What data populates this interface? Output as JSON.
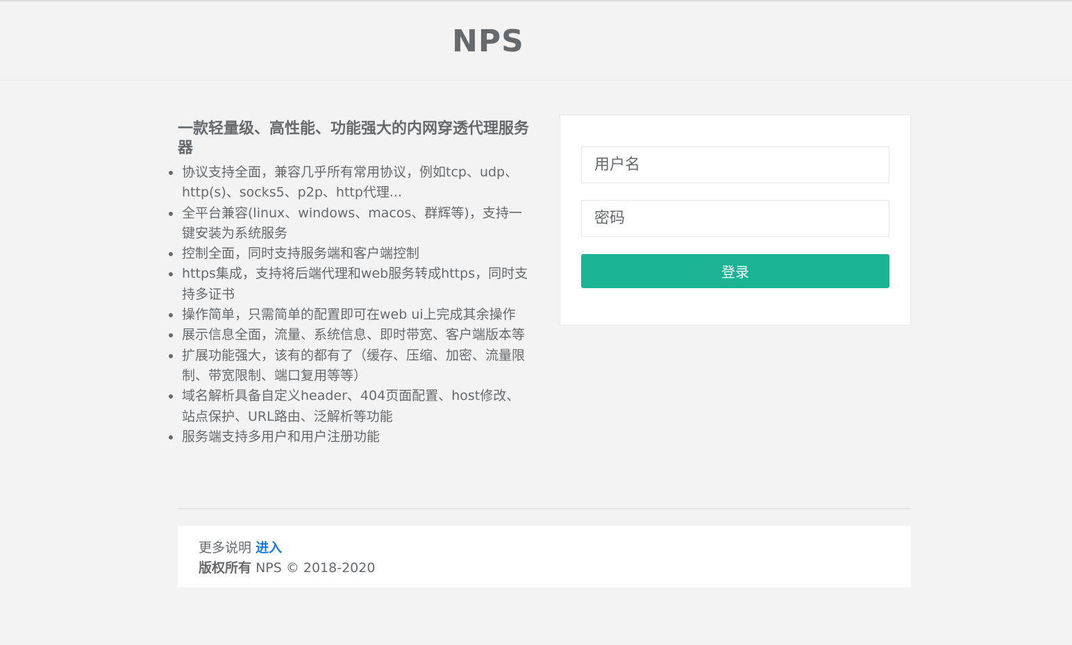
{
  "header": {
    "brand": "NPS"
  },
  "intro": {
    "title": "一款轻量级、高性能、功能强大的内网穿透代理服务器",
    "features": [
      "协议支持全面，兼容几乎所有常用协议，例如tcp、udp、http(s)、socks5、p2p、http代理...",
      "全平台兼容(linux、windows、macos、群辉等)，支持一键安装为系统服务",
      "控制全面，同时支持服务端和客户端控制",
      "https集成，支持将后端代理和web服务转成https，同时支持多证书",
      "操作简单，只需简单的配置即可在web ui上完成其余操作",
      "展示信息全面，流量、系统信息、即时带宽、客户端版本等",
      "扩展功能强大，该有的都有了（缓存、压缩、加密、流量限制、带宽限制、端口复用等等）",
      "域名解析具备自定义header、404页面配置、host修改、站点保护、URL路由、泛解析等功能",
      "服务端支持多用户和用户注册功能"
    ]
  },
  "login": {
    "username_placeholder": "用户名",
    "password_placeholder": "密码",
    "submit_label": "登录"
  },
  "footer": {
    "more_label": "更多说明",
    "more_link": "进入",
    "copyright_label": "版权所有",
    "copyright_text": "NPS © 2018-2020"
  },
  "colors": {
    "accent": "#1ab394",
    "link": "#1a7bde",
    "text": "#676a6c",
    "background": "#f3f3f4"
  }
}
